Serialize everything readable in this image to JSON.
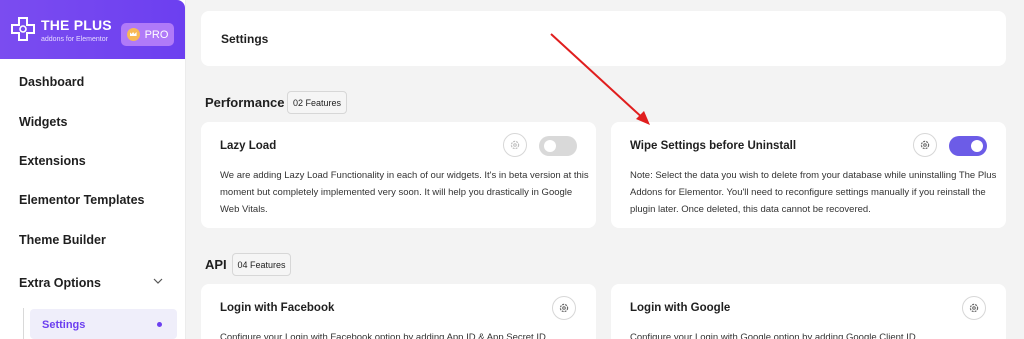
{
  "brand": {
    "title": "THE PLUS",
    "subtitle": "addons for Elementor",
    "badge": "PRO"
  },
  "sidebar": {
    "items": [
      {
        "label": "Dashboard"
      },
      {
        "label": "Widgets"
      },
      {
        "label": "Extensions"
      },
      {
        "label": "Elementor Templates"
      },
      {
        "label": "Theme Builder"
      },
      {
        "label": "Extra Options"
      }
    ],
    "submenu": [
      {
        "label": "Settings",
        "active": true
      }
    ]
  },
  "header": {
    "title": "Settings"
  },
  "sections": [
    {
      "title": "Performance",
      "badge": "02 Features",
      "cards": [
        {
          "title": "Lazy Load",
          "desc": [
            "We are adding Lazy Load Functionality in each of our widgets. It's in beta version at this",
            "moment but completely implemented very soon. It will help you drastically in Google",
            "Web Vitals."
          ],
          "enabled": false
        },
        {
          "title": "Wipe Settings before Uninstall",
          "desc": [
            "Note: Select the data you wish to delete from your database while uninstalling The Plus",
            "Addons for Elementor. You'll need to reconfigure settings manually if you reinstall the",
            "plugin later. Once deleted, this data cannot be recovered."
          ],
          "enabled": true
        }
      ]
    },
    {
      "title": "API",
      "badge": "04 Features",
      "cards": [
        {
          "title": "Login with Facebook",
          "desc": [
            "Configure your Login with Facebook option by adding App ID & App Secret ID"
          ]
        },
        {
          "title": "Login with Google",
          "desc": [
            "Configure your Login with Google option by adding Google Client ID"
          ]
        }
      ]
    }
  ],
  "colors": {
    "brand": "#6c3ff0",
    "toggle_on": "#6c5ce7",
    "toggle_off": "#d9d9d9",
    "annotation_arrow": "#e01e1e"
  }
}
